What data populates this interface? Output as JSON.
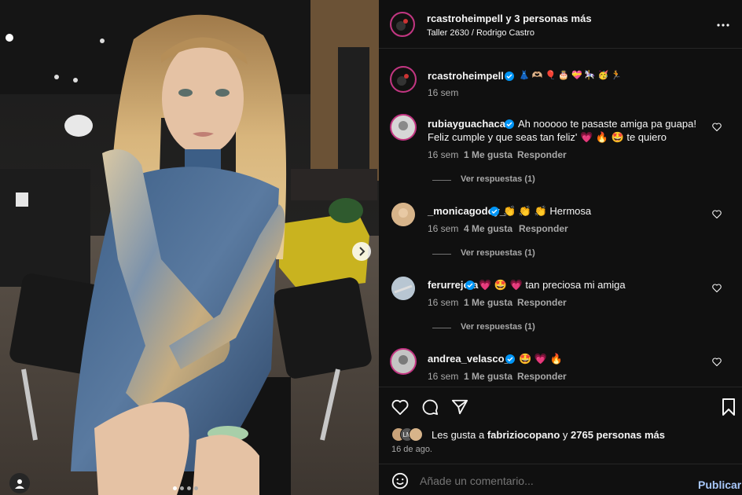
{
  "header": {
    "authors": "rcastroheimpell y 3 personas más",
    "location": "Taller 2630 / Rodrigo Castro"
  },
  "caption": {
    "username": "rcastroheimpell",
    "emojis": "👗 🫶🏼 🎈 🎂 💝 🎠 🥳 🏃",
    "time": "16 sem"
  },
  "comments": [
    {
      "username": "rubiayguachaca",
      "text_line1": "Ah nooooo te pasaste amiga pa guapa!",
      "text_line2": "Feliz cumple y que seas tan feliz' 💗 🔥 🤩 te quiero",
      "time": "16 sem",
      "likes": "1 Me gusta",
      "reply": "Responder",
      "view_replies": "Ver respuestas (1)"
    },
    {
      "username": "_monicagodoy_",
      "text_line1": "👏 👏 👏 Hermosa",
      "time": "16 sem",
      "likes": "4 Me gusta",
      "reply": "Responder",
      "view_replies": "Ver respuestas (1)"
    },
    {
      "username": "ferurrejola",
      "text_line1": "💗 🤩 💗 tan preciosa mi amiga",
      "time": "16 sem",
      "likes": "1 Me gusta",
      "reply": "Responder",
      "view_replies": "Ver respuestas (1)"
    },
    {
      "username": "andrea_velasco_",
      "text_line1": "🤩 💗 🔥",
      "time": "16 sem",
      "likes": "1 Me gusta",
      "reply": "Responder"
    }
  ],
  "likes_summary": {
    "prefix": "Les gusta a ",
    "user": "fabriziocopano",
    "middle": " y ",
    "others": "2765 personas más",
    "avatar_initials": "LM"
  },
  "post_date": "16 de ago.",
  "comment_box": {
    "placeholder": "Añade un comentario...",
    "submit": "Publicar"
  },
  "carousel": {
    "slides": 4,
    "current": 1
  },
  "colors": {
    "verified": "#0095f6",
    "submit": "#a8c7fa",
    "panel_bg": "#101010"
  }
}
